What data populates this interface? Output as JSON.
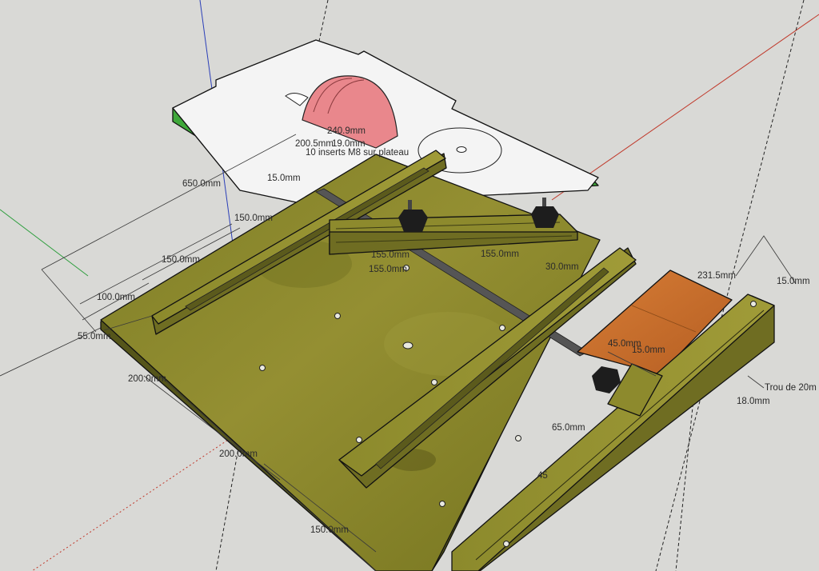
{
  "dimensions": {
    "d_650": "650.0mm",
    "d_150_a": "150.0mm",
    "d_150_b": "150.0mm",
    "d_100": "100.0mm",
    "d_55": "55.0mm",
    "d_200_a": "200.0mm",
    "d_200_b": "200.0mm",
    "d_150_c": "150.0mm",
    "d_240_9": "240.9mm",
    "d_200_5": "200.5mm",
    "d_19": "19.0mm",
    "d_15_top": "15.0mm",
    "d_155_a": "155.0mm",
    "d_155_b": "155.0mm",
    "d_155_c": "155.0mm",
    "d_30": "30.0mm",
    "d_231_5": "231.5mm",
    "d_15_right": "15.0mm",
    "d_45": "45.0mm",
    "d_15_block": "15.0mm",
    "d_65": "65.0mm",
    "d_18": "18.0mm",
    "d_45_low": "45"
  },
  "notes": {
    "inserts": "10 inserts M8 sur plateau",
    "trou": "Trou de 20m"
  },
  "colors": {
    "background": "#d9d9d6",
    "board": "#8a8a2a",
    "board_edge": "#55551a",
    "table_top": "#f4f4f4",
    "table_side": "#3fa83a",
    "blade": "#e9878c",
    "wood_block": "#c9702e",
    "knob": "#1d1d1d",
    "axis_red": "#c0392b",
    "axis_green": "#2e9e3e",
    "axis_blue": "#2b3fb8"
  }
}
